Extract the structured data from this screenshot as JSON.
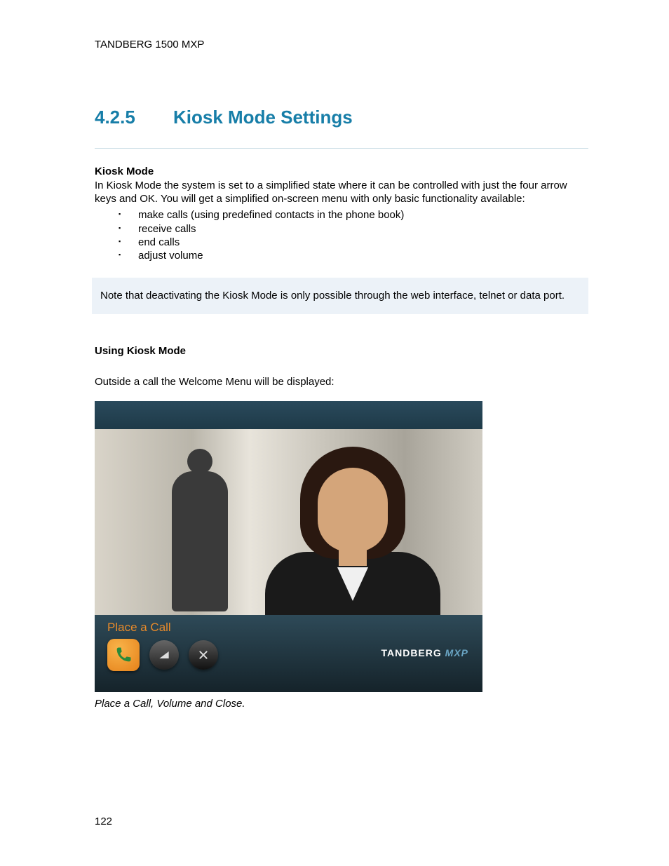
{
  "header": "TANDBERG 1500 MXP",
  "section": {
    "number": "4.2.5",
    "title": "Kiosk Mode Settings"
  },
  "kiosk": {
    "heading": "Kiosk Mode",
    "description": "In Kiosk Mode the system is set to a simplified state where it can be controlled with just the four arrow keys and OK. You will get a simplified on-screen menu with only basic functionality available:",
    "bullets": [
      "make calls (using predefined contacts in the phone book)",
      "receive calls",
      "end calls",
      "adjust volume"
    ]
  },
  "note": "Note that deactivating the Kiosk Mode is only possible through the web interface, telnet or data port.",
  "using": {
    "heading": "Using Kiosk Mode",
    "intro": "Outside a call the Welcome Menu will be displayed:"
  },
  "welcome": {
    "label": "Place a Call",
    "brand": "TANDBERG",
    "brand_suffix": "MXP"
  },
  "caption": "Place a Call, Volume and Close.",
  "page_number": "122"
}
